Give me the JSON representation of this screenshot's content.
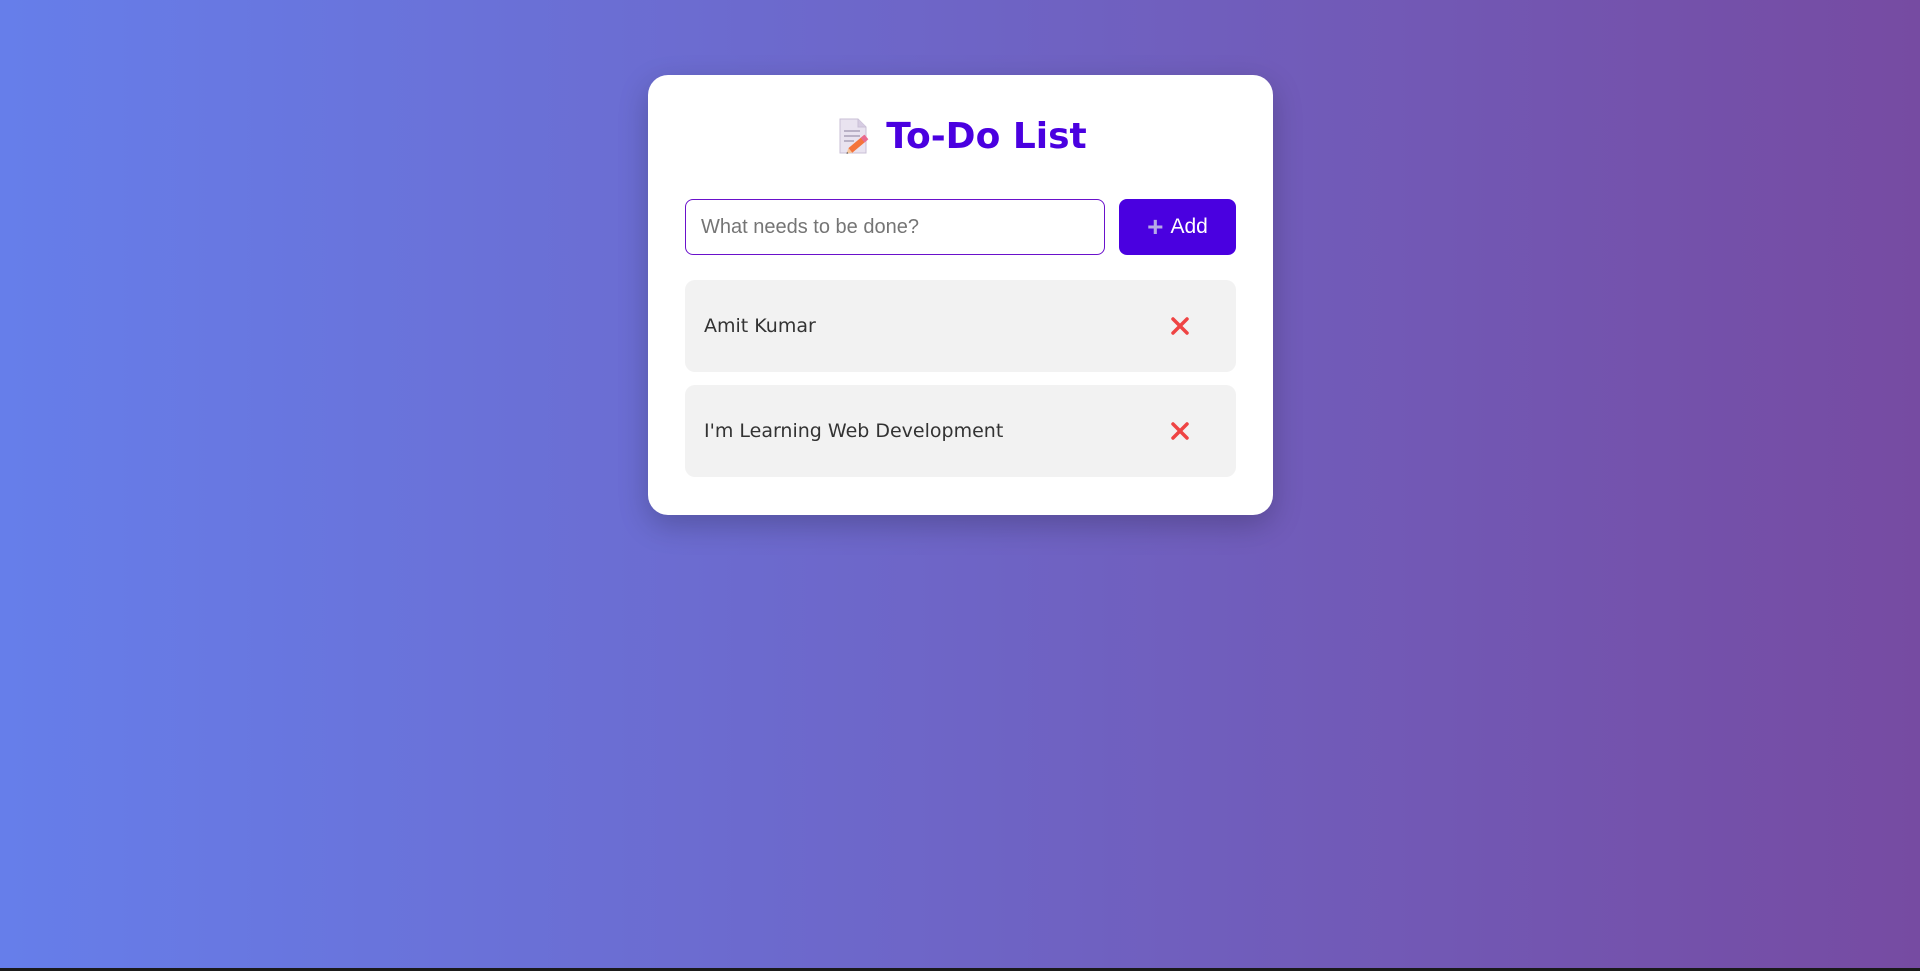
{
  "app": {
    "title": "To-Do List",
    "title_icon": "memo-icon"
  },
  "colors": {
    "accent": "#4a00e0",
    "background_gradient_start": "#667eea",
    "background_gradient_end": "#764ba2",
    "delete": "#ef4444"
  },
  "input": {
    "value": "",
    "placeholder": "What needs to be done?"
  },
  "add_button": {
    "label": "Add",
    "icon": "plus-icon"
  },
  "todos": [
    {
      "text": "Amit Kumar",
      "delete_icon": "close-icon"
    },
    {
      "text": "I'm Learning Web Development",
      "delete_icon": "close-icon"
    }
  ]
}
